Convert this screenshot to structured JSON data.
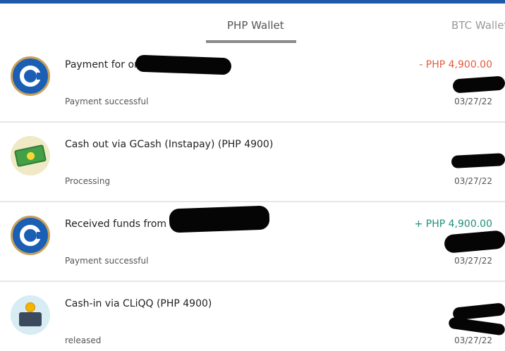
{
  "tabs": [
    {
      "label": "PHP Wallet",
      "active": true
    },
    {
      "label": "BTC Wallet",
      "active": false
    }
  ],
  "transactions": [
    {
      "title": "Payment for order",
      "status": "Payment successful",
      "amount": "- PHP 4,900.00",
      "amount_color": "#e5593b",
      "date": "03/27/22",
      "icon": "coins-ph-logo-icon"
    },
    {
      "title": "Cash out via GCash (Instapay) (PHP 4900)",
      "status": "Processing",
      "amount": "",
      "date": "03/27/22",
      "icon": "cash-bill-icon"
    },
    {
      "title": "Received funds from order #e9",
      "status": "Payment successful",
      "amount": "+ PHP 4,900.00",
      "amount_color": "#1e8f7a",
      "date": "03/27/22",
      "icon": "coins-ph-logo-icon"
    },
    {
      "title": "Cash-in via CLiQQ (PHP 4900)",
      "status": "released",
      "amount": "",
      "date": "03/27/22",
      "icon": "wallet-coin-icon"
    }
  ],
  "colors": {
    "top_bar": "#1e5aa8",
    "negative": "#e5593b",
    "positive": "#1e8f7a",
    "redaction": "#050505"
  }
}
